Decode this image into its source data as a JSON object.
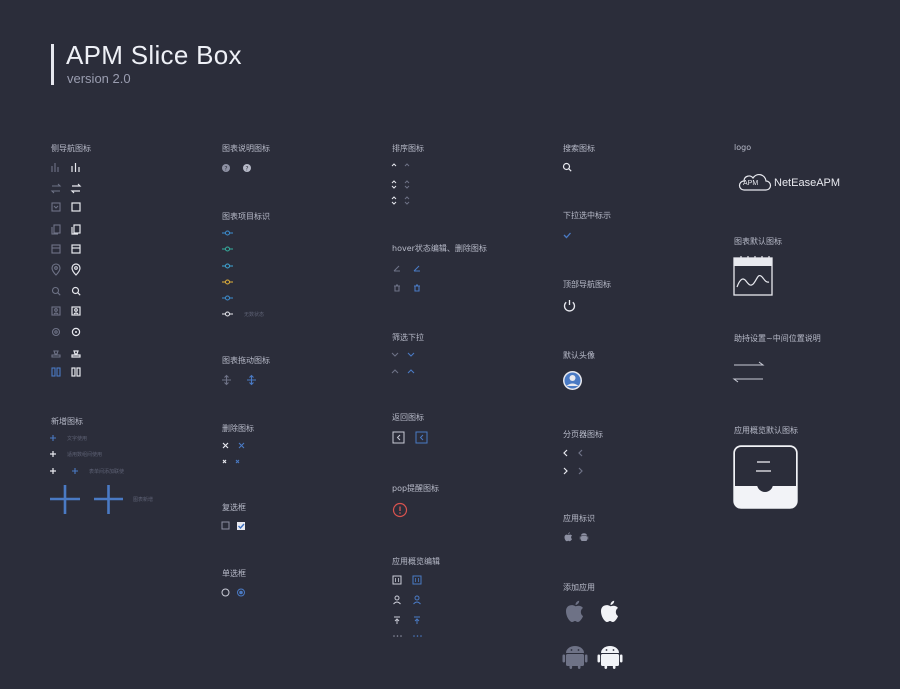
{
  "header": {
    "title": "APM Slice Box",
    "version": "version 2.0"
  },
  "sections": {
    "side_nav": "侧导航图标",
    "add": "新增图标",
    "chart_help": "图表说明图标",
    "chart_item": "图表项目标识",
    "chart_drag": "图表拖动图标",
    "delete": "删除图标",
    "checkbox": "复选框",
    "radio": "单选框",
    "sort": "排序图标",
    "hover_edit": "hover状态编辑、删除图标",
    "filter": "筛选下拉",
    "back": "返回图标",
    "pop": "pop提醒图标",
    "app_edit": "应用概览编辑",
    "search": "搜索图标",
    "dropdown_check": "下拉选中标示",
    "top_nav": "顶部导航图标",
    "avatar": "默认头像",
    "pager": "分页器图标",
    "app_mark": "应用标识",
    "add_app": "添加应用",
    "logo": "logo",
    "chart_default": "图表默认图标",
    "threshold": "助持设置~中间位置说明",
    "app_default": "应用概览默认图标"
  },
  "add_notes": [
    "文字使用",
    "适用数组间使用",
    "表单间添加联使",
    "图表新增"
  ],
  "chart_item_note": "无数状态",
  "logo": {
    "badge": "APM",
    "text": "NetEaseAPM"
  },
  "colors": {
    "bg": "#2b2d3a",
    "accent": "#4a7ac4",
    "muted": "#6e7286",
    "light": "#e8e9ef",
    "danger": "#d9534f"
  },
  "chart_item_colors": [
    "#3d8fd1",
    "#36b0a0",
    "#3fa7d6",
    "#e2b13a",
    "#3d8fd1",
    "#e8e9ef"
  ]
}
